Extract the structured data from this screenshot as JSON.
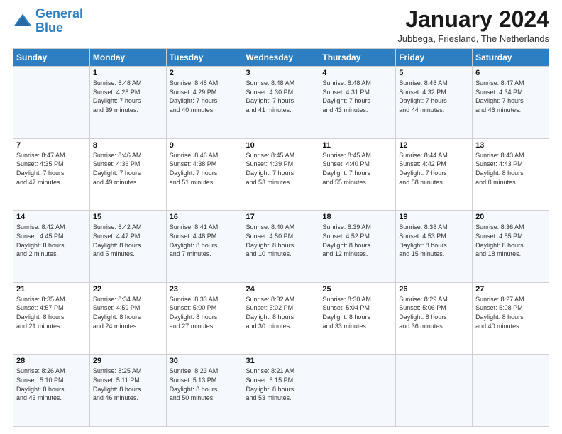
{
  "header": {
    "logo_line1": "General",
    "logo_line2": "Blue",
    "month_title": "January 2024",
    "subtitle": "Jubbega, Friesland, The Netherlands"
  },
  "days_of_week": [
    "Sunday",
    "Monday",
    "Tuesday",
    "Wednesday",
    "Thursday",
    "Friday",
    "Saturday"
  ],
  "weeks": [
    [
      {
        "day": "",
        "info": ""
      },
      {
        "day": "1",
        "info": "Sunrise: 8:48 AM\nSunset: 4:28 PM\nDaylight: 7 hours\nand 39 minutes."
      },
      {
        "day": "2",
        "info": "Sunrise: 8:48 AM\nSunset: 4:29 PM\nDaylight: 7 hours\nand 40 minutes."
      },
      {
        "day": "3",
        "info": "Sunrise: 8:48 AM\nSunset: 4:30 PM\nDaylight: 7 hours\nand 41 minutes."
      },
      {
        "day": "4",
        "info": "Sunrise: 8:48 AM\nSunset: 4:31 PM\nDaylight: 7 hours\nand 43 minutes."
      },
      {
        "day": "5",
        "info": "Sunrise: 8:48 AM\nSunset: 4:32 PM\nDaylight: 7 hours\nand 44 minutes."
      },
      {
        "day": "6",
        "info": "Sunrise: 8:47 AM\nSunset: 4:34 PM\nDaylight: 7 hours\nand 46 minutes."
      }
    ],
    [
      {
        "day": "7",
        "info": "Sunrise: 8:47 AM\nSunset: 4:35 PM\nDaylight: 7 hours\nand 47 minutes."
      },
      {
        "day": "8",
        "info": "Sunrise: 8:46 AM\nSunset: 4:36 PM\nDaylight: 7 hours\nand 49 minutes."
      },
      {
        "day": "9",
        "info": "Sunrise: 8:46 AM\nSunset: 4:38 PM\nDaylight: 7 hours\nand 51 minutes."
      },
      {
        "day": "10",
        "info": "Sunrise: 8:45 AM\nSunset: 4:39 PM\nDaylight: 7 hours\nand 53 minutes."
      },
      {
        "day": "11",
        "info": "Sunrise: 8:45 AM\nSunset: 4:40 PM\nDaylight: 7 hours\nand 55 minutes."
      },
      {
        "day": "12",
        "info": "Sunrise: 8:44 AM\nSunset: 4:42 PM\nDaylight: 7 hours\nand 58 minutes."
      },
      {
        "day": "13",
        "info": "Sunrise: 8:43 AM\nSunset: 4:43 PM\nDaylight: 8 hours\nand 0 minutes."
      }
    ],
    [
      {
        "day": "14",
        "info": "Sunrise: 8:42 AM\nSunset: 4:45 PM\nDaylight: 8 hours\nand 2 minutes."
      },
      {
        "day": "15",
        "info": "Sunrise: 8:42 AM\nSunset: 4:47 PM\nDaylight: 8 hours\nand 5 minutes."
      },
      {
        "day": "16",
        "info": "Sunrise: 8:41 AM\nSunset: 4:48 PM\nDaylight: 8 hours\nand 7 minutes."
      },
      {
        "day": "17",
        "info": "Sunrise: 8:40 AM\nSunset: 4:50 PM\nDaylight: 8 hours\nand 10 minutes."
      },
      {
        "day": "18",
        "info": "Sunrise: 8:39 AM\nSunset: 4:52 PM\nDaylight: 8 hours\nand 12 minutes."
      },
      {
        "day": "19",
        "info": "Sunrise: 8:38 AM\nSunset: 4:53 PM\nDaylight: 8 hours\nand 15 minutes."
      },
      {
        "day": "20",
        "info": "Sunrise: 8:36 AM\nSunset: 4:55 PM\nDaylight: 8 hours\nand 18 minutes."
      }
    ],
    [
      {
        "day": "21",
        "info": "Sunrise: 8:35 AM\nSunset: 4:57 PM\nDaylight: 8 hours\nand 21 minutes."
      },
      {
        "day": "22",
        "info": "Sunrise: 8:34 AM\nSunset: 4:59 PM\nDaylight: 8 hours\nand 24 minutes."
      },
      {
        "day": "23",
        "info": "Sunrise: 8:33 AM\nSunset: 5:00 PM\nDaylight: 8 hours\nand 27 minutes."
      },
      {
        "day": "24",
        "info": "Sunrise: 8:32 AM\nSunset: 5:02 PM\nDaylight: 8 hours\nand 30 minutes."
      },
      {
        "day": "25",
        "info": "Sunrise: 8:30 AM\nSunset: 5:04 PM\nDaylight: 8 hours\nand 33 minutes."
      },
      {
        "day": "26",
        "info": "Sunrise: 8:29 AM\nSunset: 5:06 PM\nDaylight: 8 hours\nand 36 minutes."
      },
      {
        "day": "27",
        "info": "Sunrise: 8:27 AM\nSunset: 5:08 PM\nDaylight: 8 hours\nand 40 minutes."
      }
    ],
    [
      {
        "day": "28",
        "info": "Sunrise: 8:26 AM\nSunset: 5:10 PM\nDaylight: 8 hours\nand 43 minutes."
      },
      {
        "day": "29",
        "info": "Sunrise: 8:25 AM\nSunset: 5:11 PM\nDaylight: 8 hours\nand 46 minutes."
      },
      {
        "day": "30",
        "info": "Sunrise: 8:23 AM\nSunset: 5:13 PM\nDaylight: 8 hours\nand 50 minutes."
      },
      {
        "day": "31",
        "info": "Sunrise: 8:21 AM\nSunset: 5:15 PM\nDaylight: 8 hours\nand 53 minutes."
      },
      {
        "day": "",
        "info": ""
      },
      {
        "day": "",
        "info": ""
      },
      {
        "day": "",
        "info": ""
      }
    ]
  ]
}
